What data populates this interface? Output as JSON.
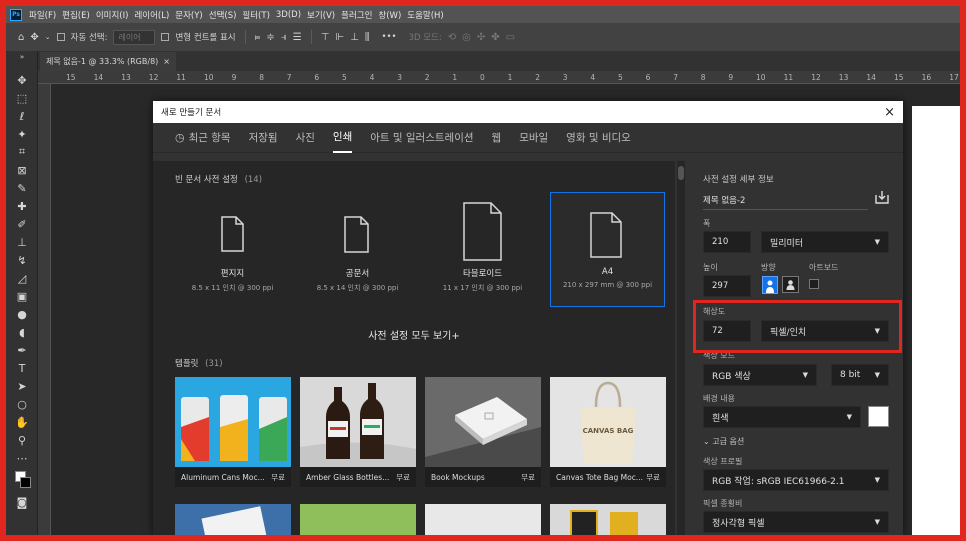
{
  "menu": {
    "logo": "Ps",
    "items": [
      "파일(F)",
      "편집(E)",
      "이미지(I)",
      "레이어(L)",
      "문자(Y)",
      "선택(S)",
      "필터(T)",
      "3D(D)",
      "보기(V)",
      "플러그인",
      "창(W)",
      "도움말(H)"
    ]
  },
  "options": {
    "auto_select": "자동 선택:",
    "layer_select": "레이어",
    "transform": "변형 컨트롤 표시",
    "more": "•••",
    "mode3d": "3D 모드:"
  },
  "document_tab": {
    "title": "제목 없음-1 @ 33.3% (RGB/8)",
    "close": "×"
  },
  "ruler_labels": [
    "15",
    "14",
    "13",
    "12",
    "11",
    "10",
    "9",
    "8",
    "7",
    "6",
    "5",
    "4",
    "3",
    "2",
    "1",
    "0",
    "1",
    "2",
    "3",
    "4",
    "5",
    "6",
    "7",
    "8",
    "9",
    "10",
    "11",
    "12",
    "13",
    "14",
    "15",
    "16",
    "17"
  ],
  "dialog": {
    "title": "새로 만들기 문서",
    "close": "×",
    "tabs": [
      "최근 항목",
      "저장됨",
      "사진",
      "인쇄",
      "아트 및 일러스트레이션",
      "웹",
      "모바일",
      "영화 및 비디오"
    ],
    "blank_presets_label": "빈 문서 사전 설정",
    "blank_presets_count": "(14)",
    "presets": [
      {
        "name": "편지지",
        "size": "8.5 x 11 인치 @ 300 ppi"
      },
      {
        "name": "공문서",
        "size": "8.5 x 14 인치 @ 300 ppi"
      },
      {
        "name": "타블로이드",
        "size": "11 x 17 인치 @ 300 ppi"
      },
      {
        "name": "A4",
        "size": "210 x 297 mm @ 300 ppi"
      }
    ],
    "see_all": "사전 설정 모두 보기+",
    "templates_label": "템플릿",
    "templates_count": "(31)",
    "templates": [
      {
        "name": "Aluminum Cans Moc...",
        "badge": "무료"
      },
      {
        "name": "Amber Glass Bottles...",
        "badge": "무료"
      },
      {
        "name": "Book Mockups",
        "badge": "무료"
      },
      {
        "name": "Canvas Tote Bag Moc...",
        "badge": "무료"
      }
    ],
    "tote_text": "CANVAS BAG",
    "details": {
      "header": "사전 설정 세부 정보",
      "doc_name": "제목 없음-2",
      "width_label": "폭",
      "width_value": "210",
      "width_unit": "밀리미터",
      "height_label": "높이",
      "height_value": "297",
      "orientation_label": "방향",
      "artboard_label": "아트보드",
      "resolution_label": "해상도",
      "resolution_value": "72",
      "resolution_unit": "픽셀/인치",
      "color_mode_label": "색상 모드",
      "color_mode": "RGB 색상",
      "bit_depth": "8 bit",
      "background_label": "배경 내용",
      "background": "흰색",
      "advanced_label": "고급 옵션",
      "color_profile_label": "색상 프로필",
      "color_profile": "RGB 작업: sRGB IEC61966-2.1",
      "pixel_ratio_label": "픽셀 종횡비",
      "pixel_ratio": "정사각형 픽셀"
    }
  },
  "colors": {
    "highlight": "#e0261e",
    "accent": "#1473e6"
  }
}
